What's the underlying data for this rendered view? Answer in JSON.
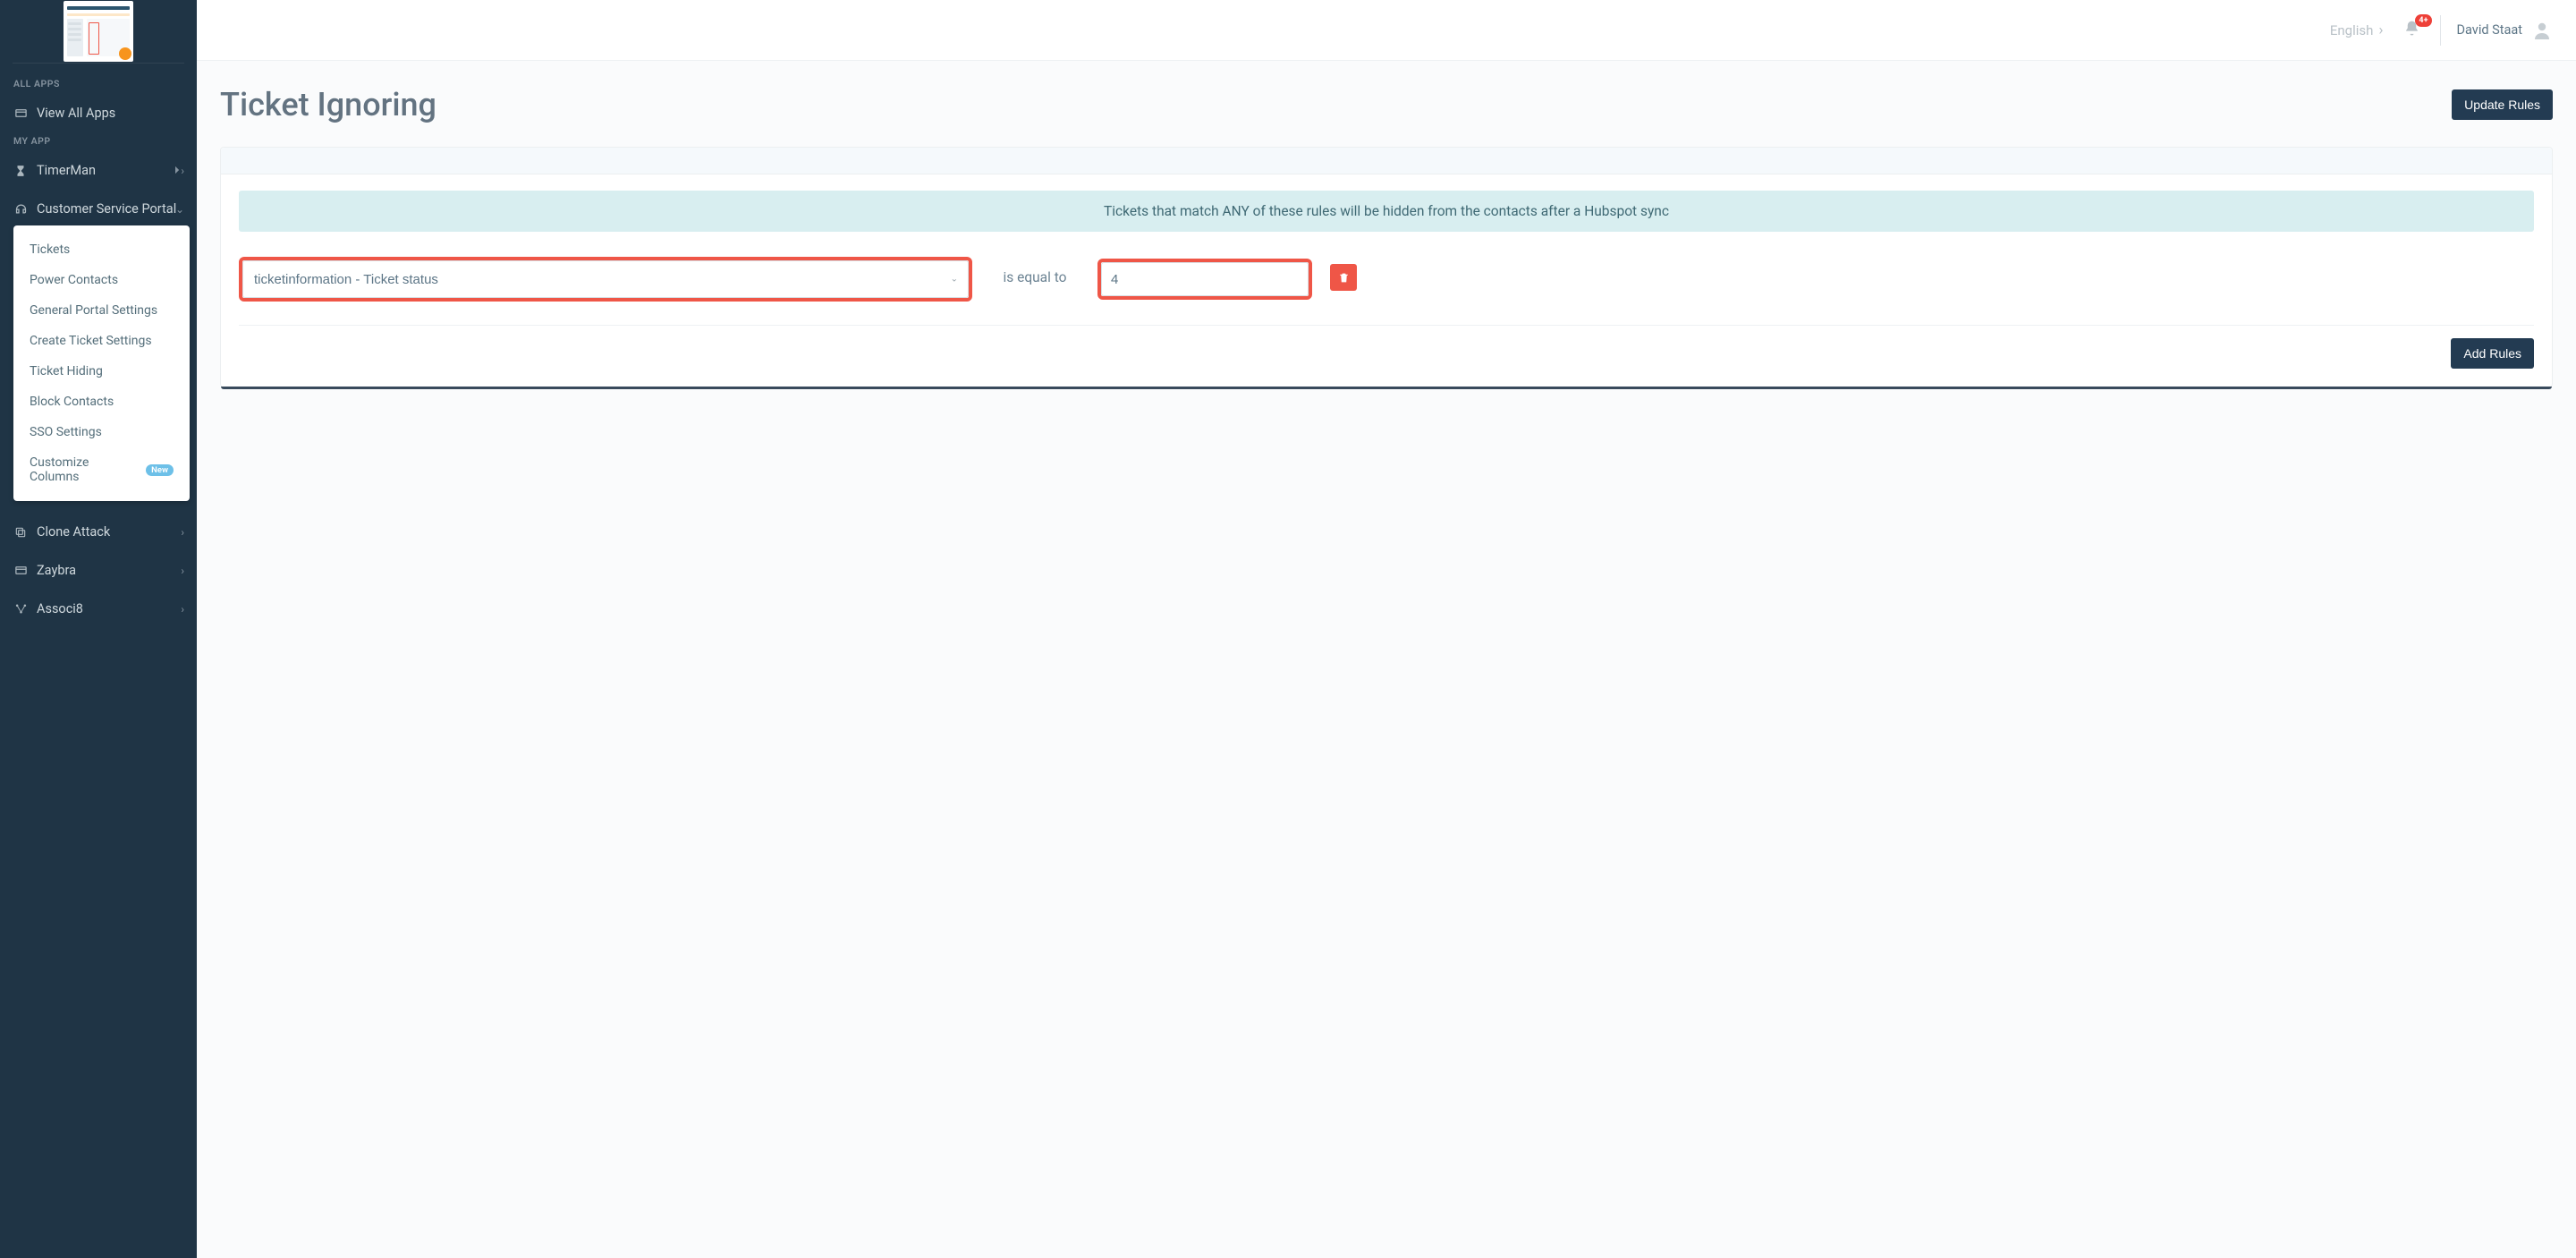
{
  "header": {
    "language_label": "English",
    "notification_badge": "4+",
    "user_name": "David Staat"
  },
  "sidebar": {
    "section_all_apps": "ALL APPS",
    "view_all_apps": "View All Apps",
    "section_my_app": "MY APP",
    "items": [
      {
        "label": "TimerMan"
      },
      {
        "label": "Customer Service Portal"
      },
      {
        "label": "Clone Attack"
      },
      {
        "label": "Zaybra"
      },
      {
        "label": "Associ8"
      }
    ],
    "submenu": [
      {
        "label": "Tickets"
      },
      {
        "label": "Power Contacts"
      },
      {
        "label": "General Portal Settings"
      },
      {
        "label": "Create Ticket Settings"
      },
      {
        "label": "Ticket Hiding"
      },
      {
        "label": "Block Contacts"
      },
      {
        "label": "SSO Settings"
      },
      {
        "label": "Customize Columns",
        "badge": "New"
      }
    ]
  },
  "page": {
    "title": "Ticket Ignoring",
    "update_rules_btn": "Update Rules",
    "info_text": "Tickets that match ANY of these rules will be hidden from the contacts after a Hubspot sync",
    "rule": {
      "field_selected": "ticketinformation - Ticket status",
      "operator": "is equal to",
      "value": "4"
    },
    "add_rules_btn": "Add Rules"
  }
}
